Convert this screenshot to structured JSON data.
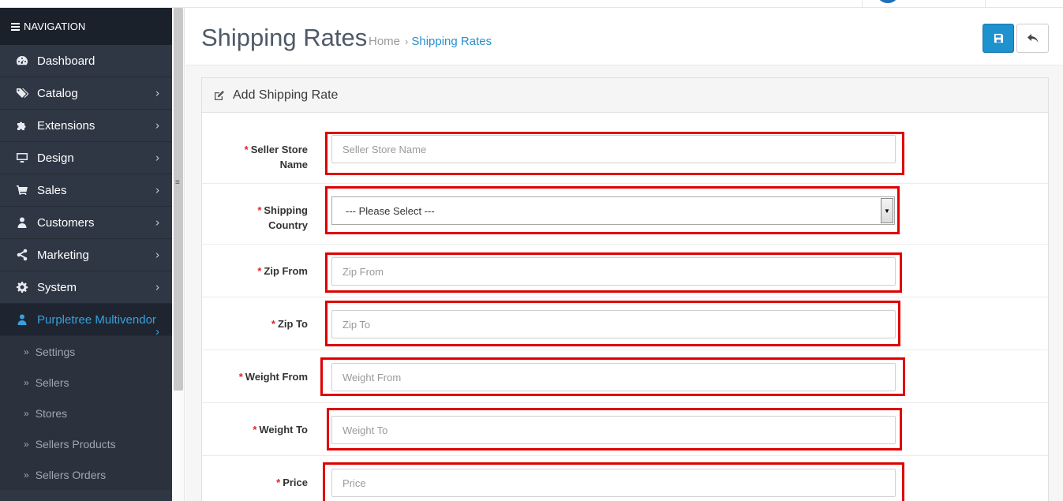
{
  "sidebar": {
    "heading": "NAVIGATION",
    "items": [
      {
        "label": "Dashboard",
        "icon": "dashboard-icon",
        "chevron": ""
      },
      {
        "label": "Catalog",
        "icon": "tags-icon",
        "chevron": "›"
      },
      {
        "label": "Extensions",
        "icon": "puzzle-icon",
        "chevron": "›"
      },
      {
        "label": "Design",
        "icon": "monitor-icon",
        "chevron": "›"
      },
      {
        "label": "Sales",
        "icon": "cart-icon",
        "chevron": "›"
      },
      {
        "label": "Customers",
        "icon": "user-icon",
        "chevron": "›"
      },
      {
        "label": "Marketing",
        "icon": "share-icon",
        "chevron": "›"
      },
      {
        "label": "System",
        "icon": "gear-icon",
        "chevron": "›"
      },
      {
        "label": "Purpletree Multivendor",
        "icon": "user-icon",
        "chevron": "›"
      }
    ],
    "subitems": [
      {
        "label": "Settings"
      },
      {
        "label": "Sellers"
      },
      {
        "label": "Stores"
      },
      {
        "label": "Sellers Products"
      },
      {
        "label": "Sellers Orders"
      }
    ]
  },
  "header": {
    "title": "Shipping Rates",
    "breadcrumb_home": "Home",
    "breadcrumb_current": "Shipping Rates",
    "save_icon": "floppy-disk-icon",
    "back_icon": "reply-icon"
  },
  "panel": {
    "title": "Add Shipping Rate"
  },
  "form": {
    "required_mark": "*",
    "seller_store_name": {
      "label_line1": "Seller Store",
      "label_line2": "Name",
      "placeholder": "Seller Store Name"
    },
    "shipping_country": {
      "label_line1": "Shipping",
      "label_line2": "Country",
      "selected": "--- Please Select ---"
    },
    "zip_from": {
      "label": "Zip From",
      "placeholder": "Zip From"
    },
    "zip_to": {
      "label": "Zip To",
      "placeholder": "Zip To"
    },
    "weight_from": {
      "label": "Weight From",
      "placeholder": "Weight From"
    },
    "weight_to": {
      "label": "Weight To",
      "placeholder": "Weight To"
    },
    "price": {
      "label": "Price",
      "placeholder": "Price"
    }
  },
  "colors": {
    "sidebar_bg": "#2f3744",
    "accent": "#1e91cf",
    "highlight": "#e00000",
    "required": "#e3231f"
  }
}
